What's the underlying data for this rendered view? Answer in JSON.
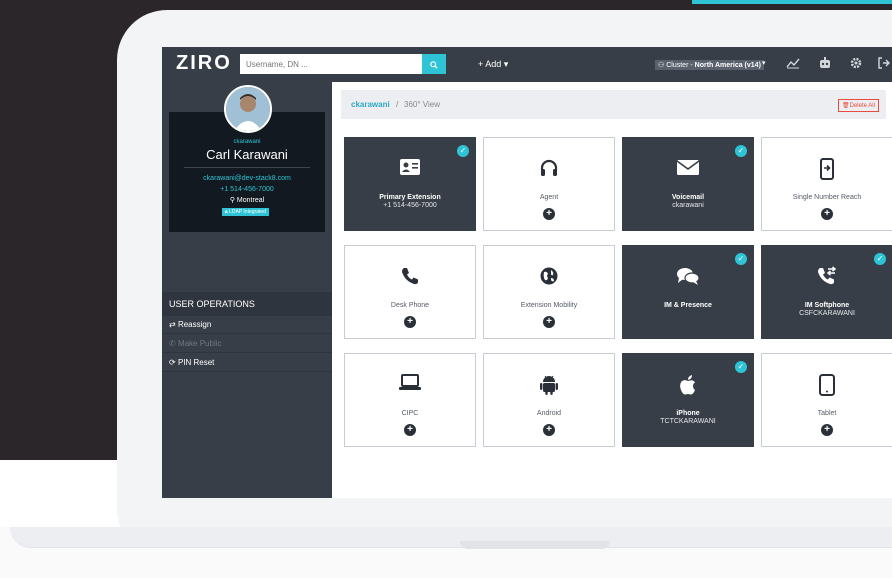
{
  "colors": {
    "accent": "#2ec4d6",
    "sidebar": "#383e48",
    "danger": "#e74c3c"
  },
  "header": {
    "logo": "ZIRO",
    "search_placeholder": "Username, DN ...",
    "search_icon": "search-icon",
    "add_label": "+ Add ▾",
    "cluster_prefix": "Cluster - ",
    "cluster_value": "North America (v14)",
    "cluster_caret": "▾"
  },
  "profile": {
    "username": "ckarawani",
    "full_name": "Carl Karawani",
    "email": "ckarawani@dev-stack8.com",
    "phone": "+1 514-456-7000",
    "location": "Montreal",
    "ldap_badge": "LDAP Integrated"
  },
  "operations": {
    "header": "USER OPERATIONS",
    "items": [
      {
        "label": "Reassign",
        "enabled": true
      },
      {
        "label": "Make Public",
        "enabled": false
      },
      {
        "label": "PIN Reset",
        "enabled": true
      }
    ]
  },
  "breadcrumb": {
    "user": "ckarawani",
    "separator": "/",
    "page": "360° View"
  },
  "actions": {
    "delete_all": "Delete All"
  },
  "tiles": [
    {
      "name": "primary-extension",
      "label": "Primary Extension",
      "sub": "+1 514-456-7000",
      "active": true,
      "icon": "contact-card-icon"
    },
    {
      "name": "agent",
      "label": "Agent",
      "sub": "",
      "active": false,
      "icon": "headset-icon"
    },
    {
      "name": "voicemail",
      "label": "Voicemail",
      "sub": "ckarawani",
      "active": true,
      "icon": "envelope-icon"
    },
    {
      "name": "single-number-reach",
      "label": "Single Number Reach",
      "sub": "",
      "active": false,
      "icon": "mobile-forward-icon"
    },
    {
      "name": "desk-phone",
      "label": "Desk Phone",
      "sub": "",
      "active": false,
      "icon": "phone-icon"
    },
    {
      "name": "extension-mobility",
      "label": "Extension Mobility",
      "sub": "",
      "active": false,
      "icon": "globe-icon"
    },
    {
      "name": "im-presence",
      "label": "IM & Presence",
      "sub": "",
      "active": true,
      "icon": "chat-icon"
    },
    {
      "name": "im-softphone",
      "label": "IM Softphone",
      "sub": "CSFCKARAWANI",
      "active": true,
      "icon": "phone-transfer-icon"
    },
    {
      "name": "cipc",
      "label": "CIPC",
      "sub": "",
      "active": false,
      "icon": "laptop-icon"
    },
    {
      "name": "android",
      "label": "Android",
      "sub": "",
      "active": false,
      "icon": "android-icon"
    },
    {
      "name": "iphone",
      "label": "iPhone",
      "sub": "TCTCKARAWANI",
      "active": true,
      "icon": "apple-icon"
    },
    {
      "name": "tablet",
      "label": "Tablet",
      "sub": "",
      "active": false,
      "icon": "tablet-icon"
    }
  ]
}
